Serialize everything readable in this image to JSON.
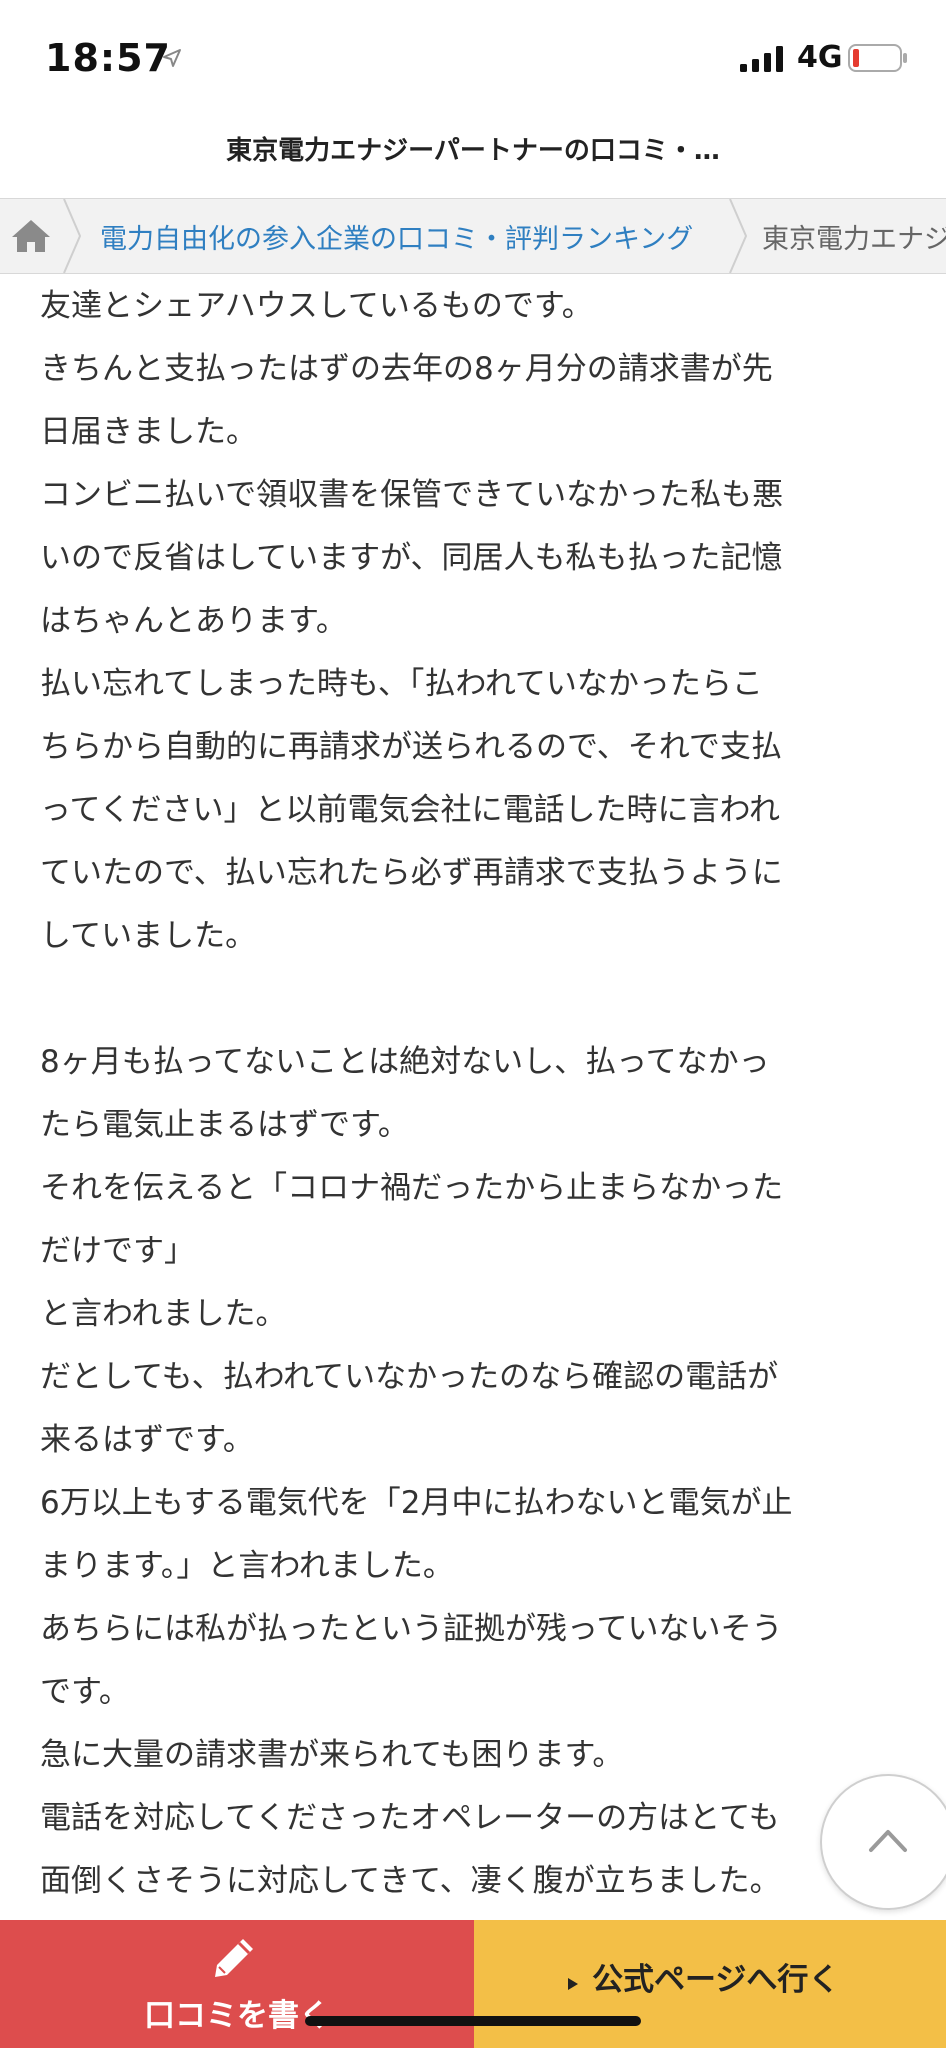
{
  "status_bar": {
    "time": "18:57",
    "network": "4G"
  },
  "header": {
    "title": "東京電力エナジーパートナーの口コミ・…"
  },
  "breadcrumb": {
    "link": "電力自由化の参入企業の口コミ・評判ランキング",
    "current": "東京電力エナジーパートナー"
  },
  "review_lines": [
    "友達とシェアハウスしているものです。",
    "きちんと支払ったはずの去年の8ヶ月分の請求書が先",
    "日届きました。",
    "コンビニ払いで領収書を保管できていなかった私も悪",
    "いので反省はしていますが、同居人も私も払った記憶",
    "はちゃんとあります。",
    "払い忘れてしまった時も、「払われていなかったらこ",
    "ちらから自動的に再請求が送られるので、それで支払",
    "ってください」と以前電気会社に電話した時に言われ",
    "ていたので、払い忘れたら必ず再請求で支払うように",
    "していました。",
    "",
    "8ヶ月も払ってないことは絶対ないし、払ってなかっ",
    "たら電気止まるはずです。",
    "それを伝えると「コロナ禍だったから止まらなかった",
    "だけです」",
    "と言われました。",
    "だとしても、払われていなかったのなら確認の電話が",
    "来るはずです。",
    "6万以上もする電気代を「2月中に払わないと電気が止",
    "まります。」と言われました。",
    "あちらには私が払ったという証拠が残っていないそう",
    "です。",
    "急に大量の請求書が来られても困ります。",
    "電話を対応してくださったオペレーターの方はとても",
    "面倒くさそうに対応してきて、凄く腹が立ちました。"
  ],
  "bottom_bar": {
    "write_label": "口コミを書く",
    "official_label": "公式ページへ行く"
  },
  "colors": {
    "write_button": "#dd4d4d",
    "official_button": "#f3bf47",
    "link": "#2f7fc1"
  },
  "icons": [
    "location-arrow-icon",
    "signal-icon",
    "battery-icon",
    "home-icon",
    "chevron-up-icon",
    "pencil-icon",
    "triangle-arrow-icon"
  ]
}
